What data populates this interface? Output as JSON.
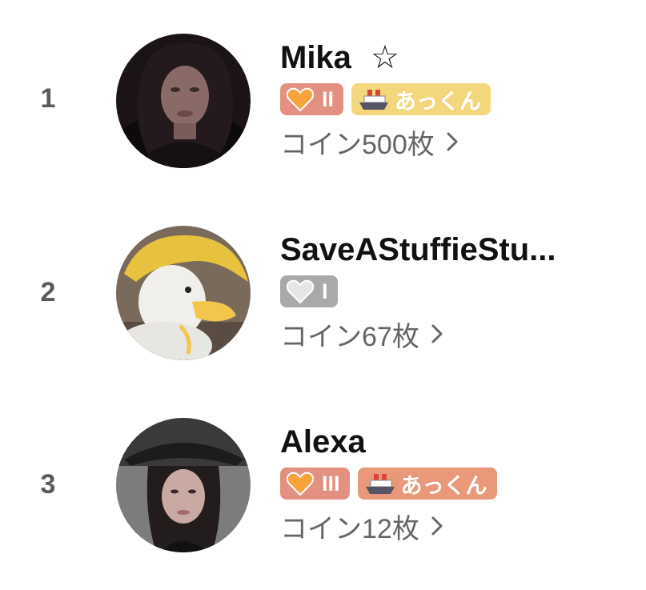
{
  "colors": {
    "rank_text": "#5a5a5a",
    "name_text": "#111111",
    "coin_text": "#666666",
    "heart_badge_orange": "#e49080",
    "heart_badge_gray": "#a9a9a9",
    "ship_badge_yellow": "#f4d67c",
    "ship_badge_orange": "#e9987a"
  },
  "rows": [
    {
      "rank": "1",
      "name": "Mika",
      "star": "☆",
      "heart_badge": {
        "icon": "orange-heart-icon",
        "level": "II"
      },
      "ship_badge": {
        "icon": "ship-icon",
        "label": "あっくん"
      },
      "coins": "コイン500枚",
      "chevron": "›"
    },
    {
      "rank": "2",
      "name": "SaveAStuffieStu...",
      "heart_badge": {
        "icon": "white-heart-icon",
        "level": "I"
      },
      "coins": "コイン67枚",
      "chevron": "›"
    },
    {
      "rank": "3",
      "name": "Alexa",
      "heart_badge": {
        "icon": "orange-heart-icon",
        "level": "III"
      },
      "ship_badge": {
        "icon": "ship-icon",
        "label": "あっくん"
      },
      "coins": "コイン12枚",
      "chevron": "›"
    }
  ]
}
